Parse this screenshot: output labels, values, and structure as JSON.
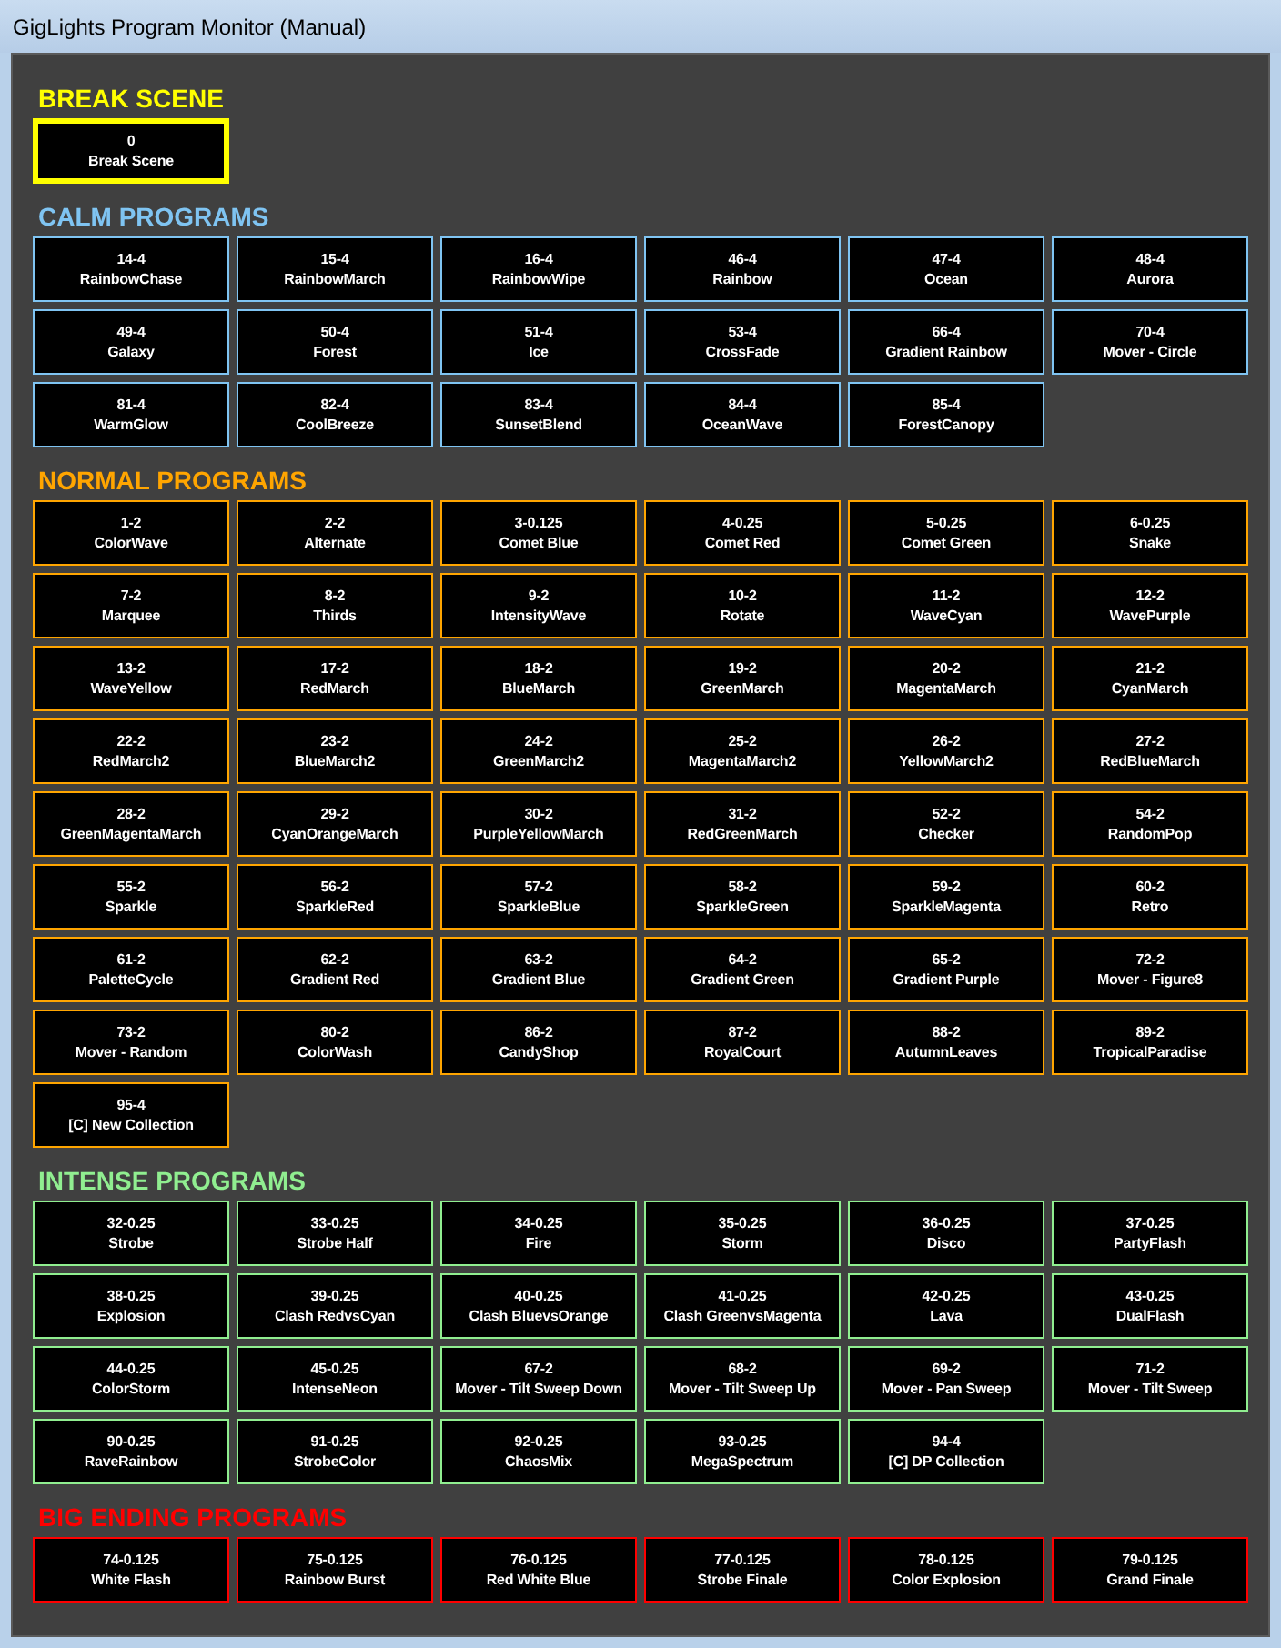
{
  "window": {
    "title": "GigLights Program Monitor (Manual)"
  },
  "sections": [
    {
      "title": "BREAK SCENE",
      "color": "#ffff00",
      "programs": [
        {
          "code": "0",
          "name": "Break Scene",
          "selected": true
        }
      ]
    },
    {
      "title": "CALM PROGRAMS",
      "color": "#7fc4f2",
      "programs": [
        {
          "code": "14-4",
          "name": "RainbowChase",
          "selected": false
        },
        {
          "code": "15-4",
          "name": "RainbowMarch",
          "selected": false
        },
        {
          "code": "16-4",
          "name": "RainbowWipe",
          "selected": false
        },
        {
          "code": "46-4",
          "name": "Rainbow",
          "selected": false
        },
        {
          "code": "47-4",
          "name": "Ocean",
          "selected": false
        },
        {
          "code": "48-4",
          "name": "Aurora",
          "selected": false
        },
        {
          "code": "49-4",
          "name": "Galaxy",
          "selected": false
        },
        {
          "code": "50-4",
          "name": "Forest",
          "selected": false
        },
        {
          "code": "51-4",
          "name": "Ice",
          "selected": false
        },
        {
          "code": "53-4",
          "name": "CrossFade",
          "selected": false
        },
        {
          "code": "66-4",
          "name": "Gradient Rainbow",
          "selected": false
        },
        {
          "code": "70-4",
          "name": "Mover - Circle",
          "selected": false
        },
        {
          "code": "81-4",
          "name": "WarmGlow",
          "selected": false
        },
        {
          "code": "82-4",
          "name": "CoolBreeze",
          "selected": false
        },
        {
          "code": "83-4",
          "name": "SunsetBlend",
          "selected": false
        },
        {
          "code": "84-4",
          "name": "OceanWave",
          "selected": false
        },
        {
          "code": "85-4",
          "name": "ForestCanopy",
          "selected": false
        }
      ]
    },
    {
      "title": "NORMAL PROGRAMS",
      "color": "#ffa500",
      "programs": [
        {
          "code": "1-2",
          "name": "ColorWave",
          "selected": false
        },
        {
          "code": "2-2",
          "name": "Alternate",
          "selected": false
        },
        {
          "code": "3-0.125",
          "name": "Comet Blue",
          "selected": false
        },
        {
          "code": "4-0.25",
          "name": "Comet Red",
          "selected": false
        },
        {
          "code": "5-0.25",
          "name": "Comet Green",
          "selected": false
        },
        {
          "code": "6-0.25",
          "name": "Snake",
          "selected": false
        },
        {
          "code": "7-2",
          "name": "Marquee",
          "selected": false
        },
        {
          "code": "8-2",
          "name": "Thirds",
          "selected": false
        },
        {
          "code": "9-2",
          "name": "IntensityWave",
          "selected": false
        },
        {
          "code": "10-2",
          "name": "Rotate",
          "selected": false
        },
        {
          "code": "11-2",
          "name": "WaveCyan",
          "selected": false
        },
        {
          "code": "12-2",
          "name": "WavePurple",
          "selected": false
        },
        {
          "code": "13-2",
          "name": "WaveYellow",
          "selected": false
        },
        {
          "code": "17-2",
          "name": "RedMarch",
          "selected": false
        },
        {
          "code": "18-2",
          "name": "BlueMarch",
          "selected": false
        },
        {
          "code": "19-2",
          "name": "GreenMarch",
          "selected": false
        },
        {
          "code": "20-2",
          "name": "MagentaMarch",
          "selected": false
        },
        {
          "code": "21-2",
          "name": "CyanMarch",
          "selected": false
        },
        {
          "code": "22-2",
          "name": "RedMarch2",
          "selected": false
        },
        {
          "code": "23-2",
          "name": "BlueMarch2",
          "selected": false
        },
        {
          "code": "24-2",
          "name": "GreenMarch2",
          "selected": false
        },
        {
          "code": "25-2",
          "name": "MagentaMarch2",
          "selected": false
        },
        {
          "code": "26-2",
          "name": "YellowMarch2",
          "selected": false
        },
        {
          "code": "27-2",
          "name": "RedBlueMarch",
          "selected": false
        },
        {
          "code": "28-2",
          "name": "GreenMagentaMarch",
          "selected": false
        },
        {
          "code": "29-2",
          "name": "CyanOrangeMarch",
          "selected": false
        },
        {
          "code": "30-2",
          "name": "PurpleYellowMarch",
          "selected": false
        },
        {
          "code": "31-2",
          "name": "RedGreenMarch",
          "selected": false
        },
        {
          "code": "52-2",
          "name": "Checker",
          "selected": false
        },
        {
          "code": "54-2",
          "name": "RandomPop",
          "selected": false
        },
        {
          "code": "55-2",
          "name": "Sparkle",
          "selected": false
        },
        {
          "code": "56-2",
          "name": "SparkleRed",
          "selected": false
        },
        {
          "code": "57-2",
          "name": "SparkleBlue",
          "selected": false
        },
        {
          "code": "58-2",
          "name": "SparkleGreen",
          "selected": false
        },
        {
          "code": "59-2",
          "name": "SparkleMagenta",
          "selected": false
        },
        {
          "code": "60-2",
          "name": "Retro",
          "selected": false
        },
        {
          "code": "61-2",
          "name": "PaletteCycle",
          "selected": false
        },
        {
          "code": "62-2",
          "name": "Gradient Red",
          "selected": false
        },
        {
          "code": "63-2",
          "name": "Gradient Blue",
          "selected": false
        },
        {
          "code": "64-2",
          "name": "Gradient Green",
          "selected": false
        },
        {
          "code": "65-2",
          "name": "Gradient Purple",
          "selected": false
        },
        {
          "code": "72-2",
          "name": "Mover - Figure8",
          "selected": false
        },
        {
          "code": "73-2",
          "name": "Mover - Random",
          "selected": false
        },
        {
          "code": "80-2",
          "name": "ColorWash",
          "selected": false
        },
        {
          "code": "86-2",
          "name": "CandyShop",
          "selected": false
        },
        {
          "code": "87-2",
          "name": "RoyalCourt",
          "selected": false
        },
        {
          "code": "88-2",
          "name": "AutumnLeaves",
          "selected": false
        },
        {
          "code": "89-2",
          "name": "TropicalParadise",
          "selected": false
        },
        {
          "code": "95-4",
          "name": "[C] New Collection",
          "selected": false
        }
      ]
    },
    {
      "title": "INTENSE PROGRAMS",
      "color": "#90ee90",
      "programs": [
        {
          "code": "32-0.25",
          "name": "Strobe",
          "selected": false
        },
        {
          "code": "33-0.25",
          "name": "Strobe Half",
          "selected": false
        },
        {
          "code": "34-0.25",
          "name": "Fire",
          "selected": false
        },
        {
          "code": "35-0.25",
          "name": "Storm",
          "selected": false
        },
        {
          "code": "36-0.25",
          "name": "Disco",
          "selected": false
        },
        {
          "code": "37-0.25",
          "name": "PartyFlash",
          "selected": false
        },
        {
          "code": "38-0.25",
          "name": "Explosion",
          "selected": false
        },
        {
          "code": "39-0.25",
          "name": "Clash RedvsCyan",
          "selected": false
        },
        {
          "code": "40-0.25",
          "name": "Clash BluevsOrange",
          "selected": false
        },
        {
          "code": "41-0.25",
          "name": "Clash GreenvsMagenta",
          "selected": false
        },
        {
          "code": "42-0.25",
          "name": "Lava",
          "selected": false
        },
        {
          "code": "43-0.25",
          "name": "DualFlash",
          "selected": false
        },
        {
          "code": "44-0.25",
          "name": "ColorStorm",
          "selected": false
        },
        {
          "code": "45-0.25",
          "name": "IntenseNeon",
          "selected": false
        },
        {
          "code": "67-2",
          "name": "Mover - Tilt Sweep Down",
          "selected": false
        },
        {
          "code": "68-2",
          "name": "Mover - Tilt Sweep Up",
          "selected": false
        },
        {
          "code": "69-2",
          "name": "Mover - Pan Sweep",
          "selected": false
        },
        {
          "code": "71-2",
          "name": "Mover - Tilt Sweep",
          "selected": false
        },
        {
          "code": "90-0.25",
          "name": "RaveRainbow",
          "selected": false
        },
        {
          "code": "91-0.25",
          "name": "StrobeColor",
          "selected": false
        },
        {
          "code": "92-0.25",
          "name": "ChaosMix",
          "selected": false
        },
        {
          "code": "93-0.25",
          "name": "MegaSpectrum",
          "selected": false
        },
        {
          "code": "94-4",
          "name": "[C] DP Collection",
          "selected": false
        }
      ]
    },
    {
      "title": "BIG ENDING PROGRAMS",
      "color": "#ff0000",
      "programs": [
        {
          "code": "74-0.125",
          "name": "White Flash",
          "selected": false
        },
        {
          "code": "75-0.125",
          "name": "Rainbow Burst",
          "selected": false
        },
        {
          "code": "76-0.125",
          "name": "Red White Blue",
          "selected": false
        },
        {
          "code": "77-0.125",
          "name": "Strobe Finale",
          "selected": false
        },
        {
          "code": "78-0.125",
          "name": "Color Explosion",
          "selected": false
        },
        {
          "code": "79-0.125",
          "name": "Grand Finale",
          "selected": false
        }
      ]
    }
  ]
}
